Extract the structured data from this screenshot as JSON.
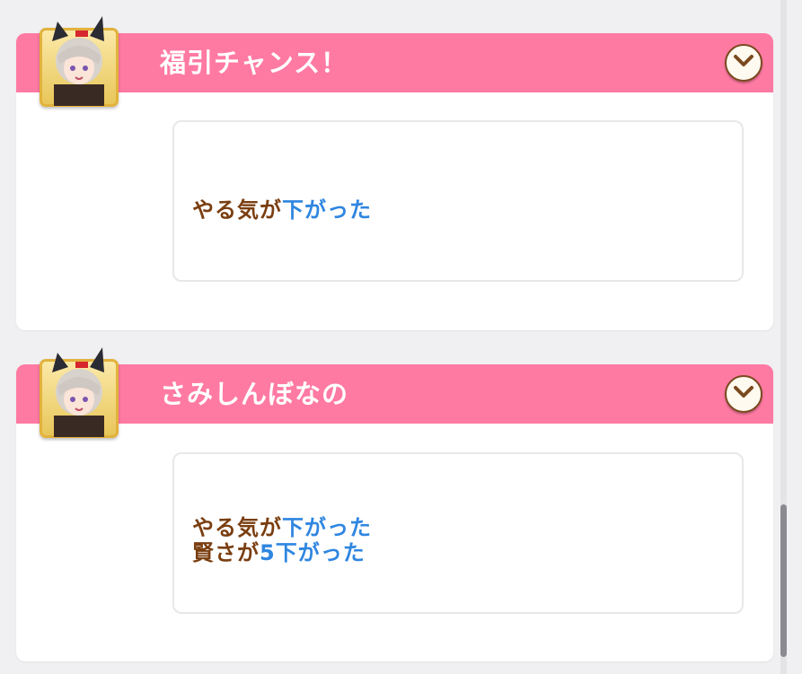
{
  "events": [
    {
      "title": "福引チャンス！",
      "lines": [
        [
          {
            "text": "やる気が",
            "color": "brown"
          },
          {
            "text": "下がった",
            "color": "blue"
          }
        ]
      ]
    },
    {
      "title": "さみしんぼなの",
      "lines": [
        [
          {
            "text": "やる気が",
            "color": "brown"
          },
          {
            "text": "下がった",
            "color": "blue"
          }
        ],
        [
          {
            "text": "賢さが",
            "color": "brown"
          },
          {
            "text": "5下がった",
            "color": "blue"
          }
        ]
      ]
    }
  ],
  "icons": {
    "avatar": "character-portrait-icon",
    "expand": "chevron-down-icon"
  },
  "colors": {
    "header_pink": "#ff7aa3",
    "text_brown": "#7a3e10",
    "text_blue": "#2f86e0"
  }
}
